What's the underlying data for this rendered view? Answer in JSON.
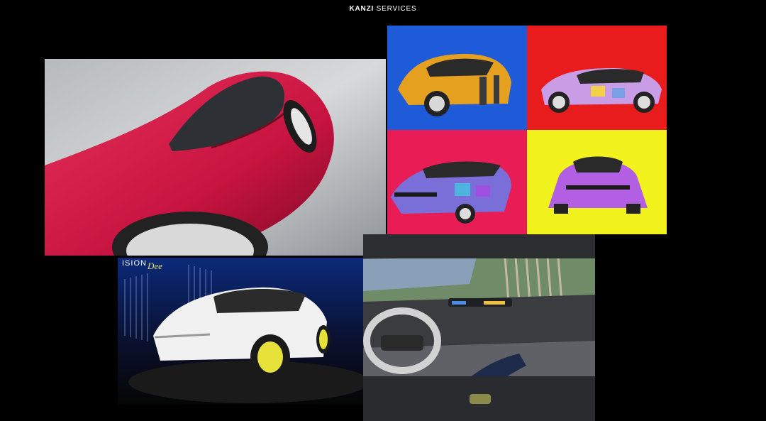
{
  "header": {
    "brand_bold": "KANZI",
    "brand_light": "SERVICES"
  },
  "images": {
    "red_car": {
      "name": "red-car-closeup-image"
    },
    "color_grid": {
      "name": "color-changing-car-grid-image",
      "cells": [
        {
          "bg": "#1e5bd8",
          "car": "#e6a020"
        },
        {
          "bg": "#e81c1c",
          "car": "#c99de6"
        },
        {
          "bg": "#e81d55",
          "car": "#7a6fd8"
        },
        {
          "bg": "#f2f21d",
          "car": "#b25fe3"
        }
      ]
    },
    "white_car": {
      "name": "white-car-stage-image",
      "sign_left": "ISION",
      "sign_right": "Dee"
    },
    "interior": {
      "name": "car-interior-image"
    }
  },
  "colors": {
    "background": "#000000",
    "text": "#ffffff"
  }
}
